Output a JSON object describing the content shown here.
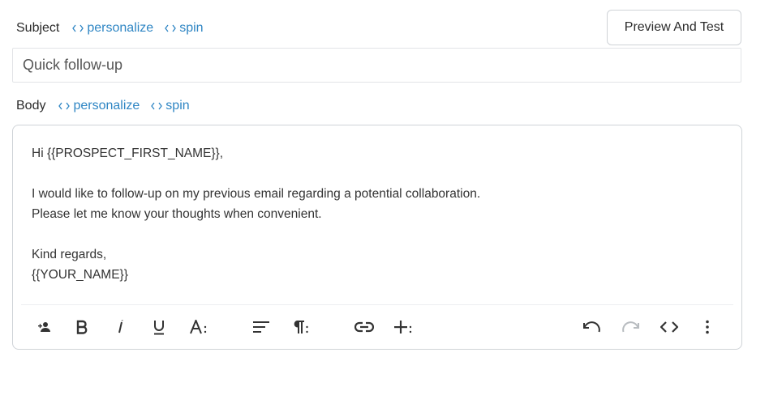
{
  "subject": {
    "label": "Subject",
    "personalize_label": "personalize",
    "spin_label": "spin",
    "value": "Quick follow-up"
  },
  "body": {
    "label": "Body",
    "personalize_label": "personalize",
    "spin_label": "spin",
    "lines": [
      "Hi {{PROSPECT_FIRST_NAME}},",
      "",
      "I would like to follow-up on my previous email regarding a potential collaboration.",
      "Please let me know your thoughts when convenient.",
      "",
      "Kind regards,",
      "{{YOUR_NAME}}"
    ]
  },
  "preview_button": {
    "label": "Preview And Test"
  },
  "toolbar": {
    "buttons": [
      {
        "icon": "add-person-icon"
      },
      {
        "icon": "bold-icon"
      },
      {
        "icon": "italic-icon"
      },
      {
        "icon": "underline-icon"
      },
      {
        "icon": "font-size-icon"
      },
      {
        "icon": "align-icon"
      },
      {
        "icon": "paragraph-icon"
      },
      {
        "icon": "link-icon"
      },
      {
        "icon": "insert-plus-icon"
      },
      {
        "icon": "undo-icon"
      },
      {
        "icon": "redo-icon",
        "disabled": true
      },
      {
        "icon": "code-view-icon"
      },
      {
        "icon": "more-vertical-icon"
      }
    ]
  },
  "colors": {
    "accent": "#2f86c4",
    "text": "#333333",
    "border": "#cfd3d7"
  }
}
